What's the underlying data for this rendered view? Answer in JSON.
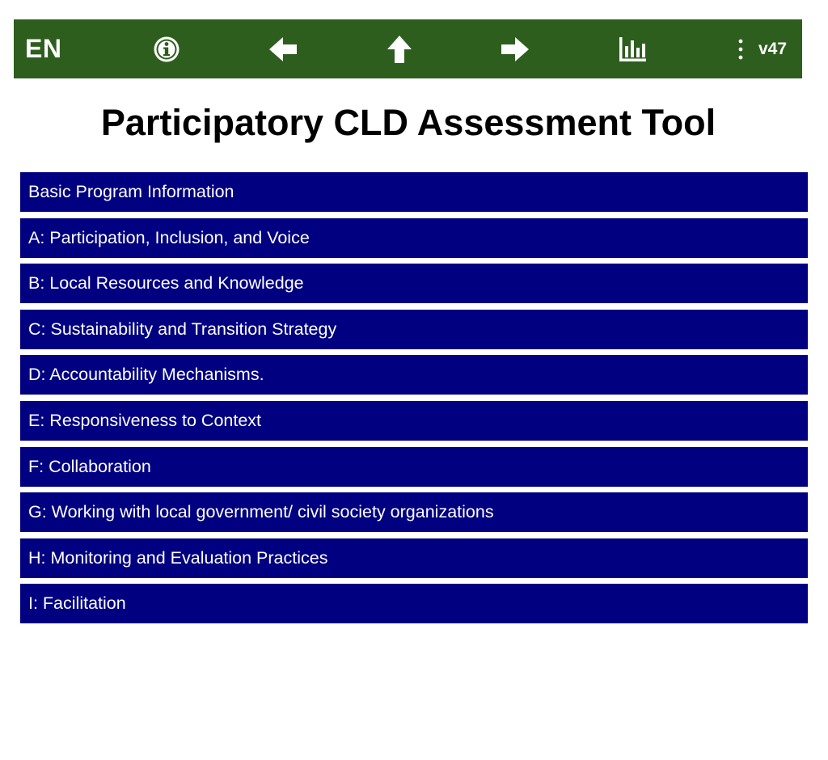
{
  "toolbar": {
    "language": "EN",
    "version": "v47",
    "icons": {
      "info": "info-icon",
      "back": "arrow-left-icon",
      "up": "arrow-up-icon",
      "forward": "arrow-right-icon",
      "stats": "bar-chart-icon",
      "menu": "more-vertical-icon"
    },
    "color": "#2d5e1e"
  },
  "page": {
    "title": "Participatory CLD Assessment Tool"
  },
  "sections": [
    {
      "label": "Basic Program Information"
    },
    {
      "label": "A: Participation, Inclusion, and Voice"
    },
    {
      "label": "B: Local Resources and Knowledge"
    },
    {
      "label": "C: Sustainability and Transition Strategy"
    },
    {
      "label": "D: Accountability Mechanisms."
    },
    {
      "label": "E: Responsiveness to Context"
    },
    {
      "label": "F: Collaboration"
    },
    {
      "label": "G: Working with local government/ civil society organizations"
    },
    {
      "label": "H: Monitoring and Evaluation Practices"
    },
    {
      "label": "I: Facilitation"
    }
  ],
  "section_color": "#000080"
}
